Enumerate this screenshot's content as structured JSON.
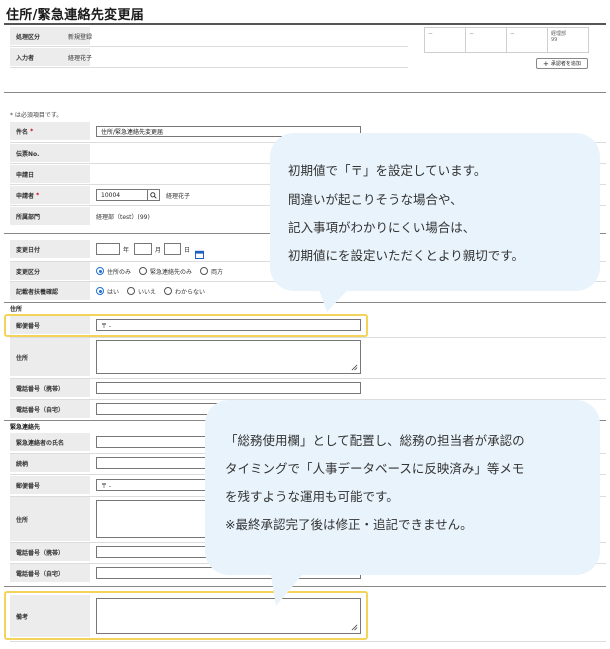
{
  "title": "住所/緊急連絡先変更届",
  "header": {
    "process_label": "処理区分",
    "process_value": "新規登録",
    "entrant_label": "入力者",
    "entrant_value": "経理花子",
    "approval_cells": [
      "－",
      "－",
      "－",
      "経理部\n99"
    ],
    "add_approver_label": "承認者を追加"
  },
  "required_note": "* は必須項目です。",
  "form": {
    "subject_label": "件名",
    "subject_value": "住所/緊急連絡先変更届",
    "slip_no_label": "伝票No.",
    "apply_date_label": "申請日",
    "applicant_label": "申請者",
    "applicant_code": "10004",
    "applicant_name": "経理花子",
    "department_label": "所属部門",
    "department_value": "経理部（test）(99)",
    "change_date_label": "変更日付",
    "year_unit": "年",
    "month_unit": "月",
    "day_unit": "日",
    "change_type_label": "変更区分",
    "change_type_options": [
      "住所のみ",
      "緊急連絡先のみ",
      "両方"
    ],
    "confirm_label": "記載者扶養確認",
    "confirm_options": [
      "はい",
      "いいえ",
      "わからない"
    ]
  },
  "address_section": {
    "section_label": "住所",
    "postal_label": "郵便番号",
    "postal_value": "〒 -",
    "address_label": "住所",
    "mobile_label": "電話番号（携帯）",
    "home_label": "電話番号（自宅）"
  },
  "emergency_section": {
    "section_label": "緊急連絡先",
    "name_label": "緊急連絡者の氏名",
    "relation_label": "続柄",
    "postal_label": "郵便番号",
    "postal_value": "〒 -",
    "address_label": "住所",
    "mobile_label": "電話番号（携帯）",
    "home_label": "電話番号（自宅）"
  },
  "remarks_label": "備考",
  "bubble1": {
    "line1": "初期値で「〒」を設定しています。",
    "line2": "間違いが起こりそうな場合や、",
    "line3": "記入事項がわかりにくい場合は、",
    "line4": "初期値にを設定いただくとより親切です。"
  },
  "bubble2": {
    "line1": "「総務使用欄」として配置し、総務の担当者が承認の",
    "line2": "タイミングで「人事データベースに反映済み」等メモ",
    "line3": "を残すような運用も可能です。",
    "line4": "※最終承認完了後は修正・追記できません。"
  },
  "colors": {
    "highlight": "#f3d35a",
    "bubble": "#e8f3fb",
    "radio_on": "#1f6fd1"
  }
}
